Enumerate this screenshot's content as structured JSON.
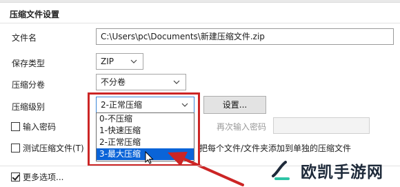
{
  "section": {
    "title": "压缩文件设置"
  },
  "filename": {
    "label": "文件名",
    "value": "C:\\Users\\pc\\Documents\\新建压缩文件.zip"
  },
  "save_type": {
    "label": "保存类型",
    "value": "ZIP"
  },
  "split": {
    "label": "压缩分卷",
    "value": "不分卷"
  },
  "level": {
    "label": "压缩级别",
    "value": "2-正常压缩",
    "options": [
      "0-不压缩",
      "1-快速压缩",
      "2-正常压缩",
      "3-最大压缩"
    ],
    "hovered_option": "3-最大压缩",
    "settings_button": "设置..."
  },
  "password": {
    "label": "输入密码",
    "checked": false,
    "reenter_label": "再次输入密码"
  },
  "test": {
    "label": "测试压缩文件(T)",
    "checked": false,
    "separate_label": "把每个文件/文件夹添加到单独的压缩文件"
  },
  "more_options": {
    "label": "更多选项...",
    "checked": true
  },
  "watermark": {
    "text": "欧凯手游网"
  },
  "colors": {
    "highlight": "#cc2525",
    "selection": "#0a64d8",
    "focus": "#3a85d6"
  }
}
